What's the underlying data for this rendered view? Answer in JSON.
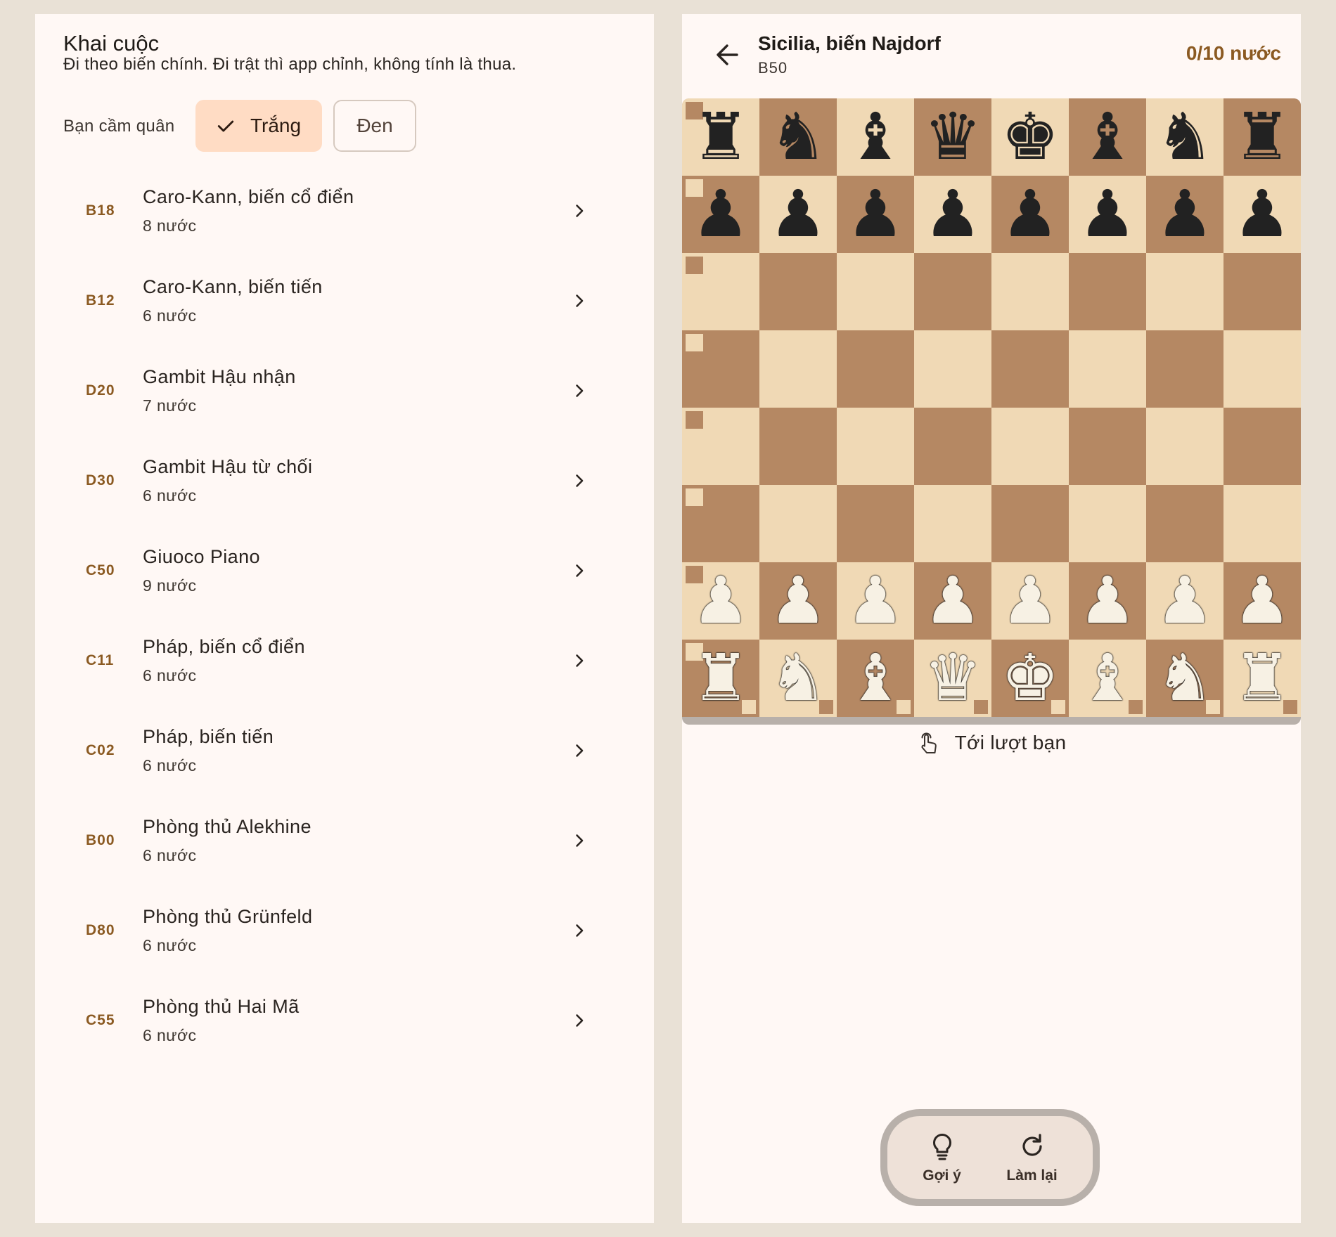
{
  "openings_panel": {
    "title": "Khai cuộc",
    "subtitle": "Đi theo biến chính. Đi trật thì app chỉnh, không tính là thua.",
    "side_label": "Bạn cầm quân",
    "side_options": {
      "white": "Trắng",
      "black": "Đen",
      "selected": "white"
    },
    "items": [
      {
        "eco": "B18",
        "name": "Caro-Kann, biến cổ điển",
        "moves": "8 nước"
      },
      {
        "eco": "B12",
        "name": "Caro-Kann, biến tiến",
        "moves": "6 nước"
      },
      {
        "eco": "D20",
        "name": "Gambit Hậu nhận",
        "moves": "7 nước"
      },
      {
        "eco": "D30",
        "name": "Gambit Hậu từ chối",
        "moves": "6 nước"
      },
      {
        "eco": "C50",
        "name": "Giuoco Piano",
        "moves": "9 nước"
      },
      {
        "eco": "C11",
        "name": "Pháp, biến cổ điển",
        "moves": "6 nước"
      },
      {
        "eco": "C02",
        "name": "Pháp, biến tiến",
        "moves": "6 nước"
      },
      {
        "eco": "B00",
        "name": "Phòng thủ Alekhine",
        "moves": "6 nước"
      },
      {
        "eco": "D80",
        "name": "Phòng thủ Grünfeld",
        "moves": "6 nước"
      },
      {
        "eco": "C55",
        "name": "Phòng thủ Hai Mã",
        "moves": "6 nước"
      }
    ]
  },
  "game": {
    "title": "Sicilia, biến Najdorf",
    "eco": "B50",
    "progress": "0/10 nước",
    "turn_status": "Tới lượt bạn",
    "hint_label": "Gợi ý",
    "reset_label": "Làm lại",
    "board": [
      "rnbqkbnr",
      "pppppppp",
      "........",
      "........",
      "........",
      "........",
      "PPPPPPPP",
      "RNBQKBNR"
    ]
  },
  "icons": {
    "back": "arrow-left-icon",
    "check": "check-icon",
    "chevron": "chevron-right-icon",
    "turn": "tap-hand-icon",
    "hint": "lightbulb-icon",
    "reset": "refresh-icon"
  },
  "colors": {
    "app_background": "#e9e1d6",
    "panel_background": "#fff8f5",
    "accent": "#8b5a22",
    "selected_chip": "#ffdcc4",
    "board_light": "#f0d9b5",
    "board_dark": "#b58863"
  }
}
